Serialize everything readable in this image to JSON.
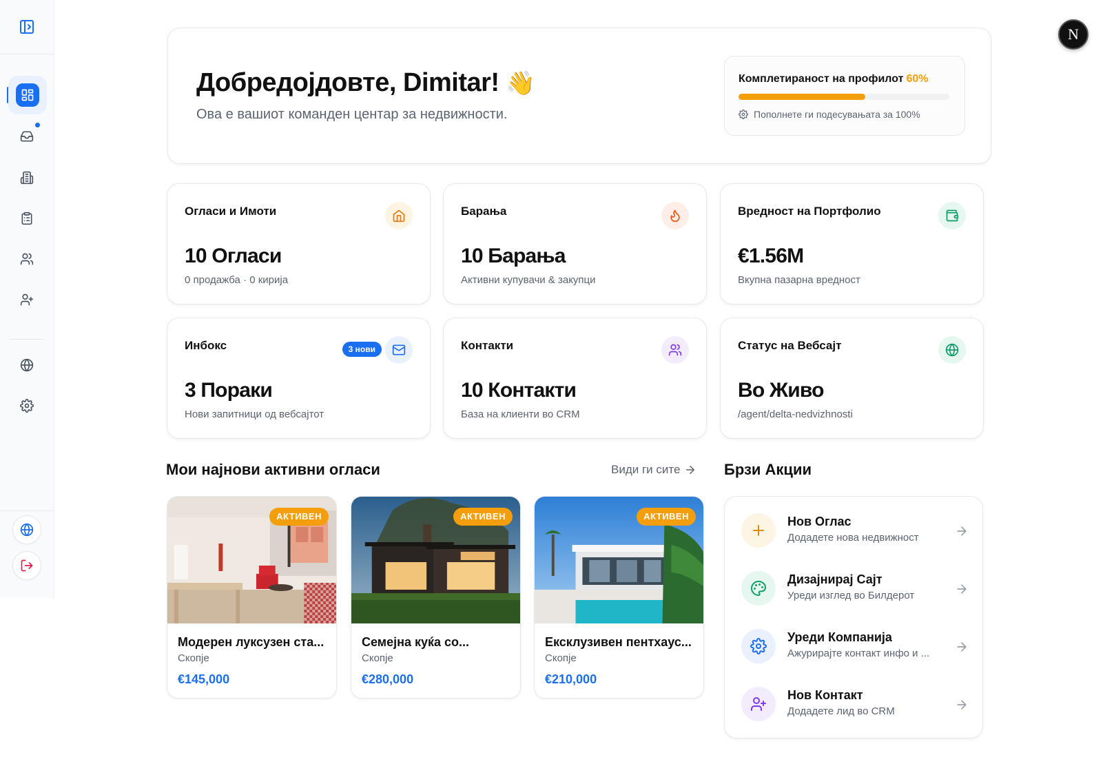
{
  "colors": {
    "accent": "#1a6ef0",
    "warning": "#f59e0b",
    "muted": "#5b6370"
  },
  "sidebar": {
    "items": [
      {
        "icon": "layout-grid-icon",
        "active": true
      },
      {
        "icon": "inbox-icon",
        "has_dot": true
      },
      {
        "icon": "building-icon"
      },
      {
        "icon": "clipboard-list-icon"
      },
      {
        "icon": "users-icon"
      },
      {
        "icon": "user-plus-icon"
      },
      {
        "icon": "globe-icon"
      },
      {
        "icon": "settings-icon"
      }
    ],
    "bottom": [
      {
        "icon": "globe-icon"
      },
      {
        "icon": "logout-icon"
      }
    ]
  },
  "user": {
    "avatar_letter": "N"
  },
  "welcome": {
    "title": "Добредојдовте, Dimitar!",
    "emoji": "👋",
    "subtitle": "Ова е вашиот команден центар за недвижности.",
    "profile": {
      "label": "Комплетираност на профилот",
      "percent_text": "60%",
      "percent": 60,
      "hint": "Пополнете ги подесувањата за 100%"
    }
  },
  "stats": [
    {
      "title": "Огласи и Имоти",
      "value": "10 Огласи",
      "sub": "0 продажба · 0 кирија",
      "icon": "home-icon"
    },
    {
      "title": "Барања",
      "value": "10 Барања",
      "sub": "Активни купувачи & закупци",
      "icon": "flame-icon"
    },
    {
      "title": "Вредност на Портфолио",
      "value": "€1.56M",
      "sub": "Вкупна пазарна вредност",
      "icon": "wallet-icon"
    },
    {
      "title": "Инбокс",
      "value": "3 Пораки",
      "sub": "Нови запитници од вебсајтот",
      "icon": "mail-icon",
      "badge": "3 нови"
    },
    {
      "title": "Контакти",
      "value": "10 Контакти",
      "sub": "База на клиенти во CRM",
      "icon": "users-icon"
    },
    {
      "title": "Статус на Вебсајт",
      "value": "Во Живо",
      "sub": "/agent/delta-nedvizhnosti",
      "icon": "globe-icon"
    }
  ],
  "listings_section": {
    "title": "Мои најнови активни огласи",
    "see_all": "Види ги сите"
  },
  "listings": [
    {
      "badge": "АКТИВЕН",
      "title": "Модерен луксузен ста...",
      "city": "Скопје",
      "price": "€145,000"
    },
    {
      "badge": "АКТИВЕН",
      "title": "Семејна куќа со...",
      "city": "Скопје",
      "price": "€280,000"
    },
    {
      "badge": "АКТИВЕН",
      "title": "Ексклузивен пентхаус...",
      "city": "Скопје",
      "price": "€210,000"
    }
  ],
  "quick_actions": {
    "title": "Брзи Акции",
    "items": [
      {
        "title": "Нов Оглас",
        "sub": "Додадете нова недвижност",
        "icon": "plus-icon"
      },
      {
        "title": "Дизајнирај Сајт",
        "sub": "Уреди изглед во Билдерот",
        "icon": "palette-icon"
      },
      {
        "title": "Уреди Компанија",
        "sub": "Ажурирајте контакт инфо и ...",
        "icon": "settings-icon"
      },
      {
        "title": "Нов Контакт",
        "sub": "Додадете лид во CRM",
        "icon": "user-plus-icon"
      }
    ]
  }
}
